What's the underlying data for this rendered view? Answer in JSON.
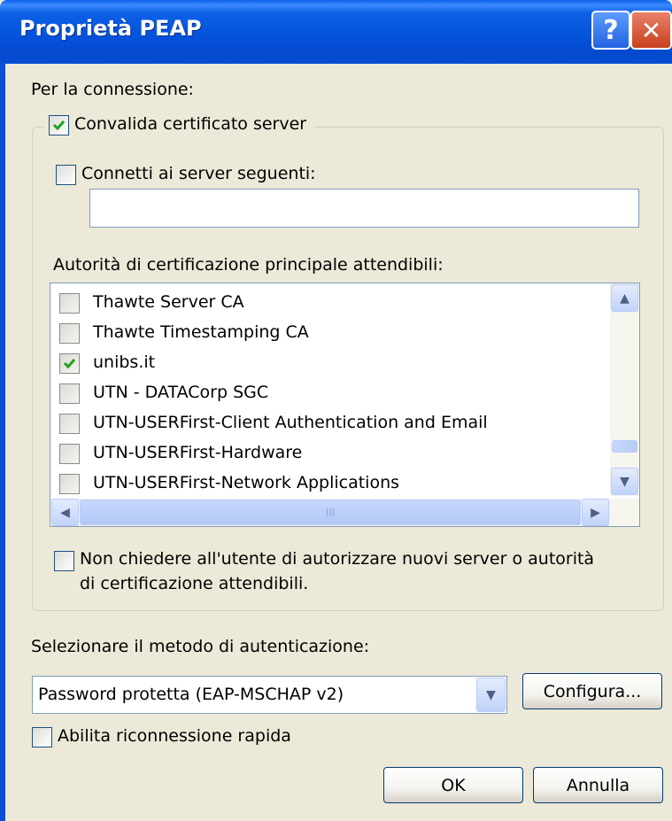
{
  "window": {
    "title": "Proprietà PEAP",
    "help_icon": "?",
    "close_icon": "✕"
  },
  "connection_label": "Per la connessione:",
  "validate_server_cert": {
    "label": "Convalida certificato server",
    "checked": true
  },
  "connect_to_servers": {
    "label": "Connetti ai server seguenti:",
    "checked": false,
    "value": ""
  },
  "trusted_root_ca": {
    "label": "Autorità di certificazione principale attendibili:",
    "items": [
      {
        "label": "Thawte Server CA",
        "checked": false
      },
      {
        "label": "Thawte Timestamping CA",
        "checked": false
      },
      {
        "label": "unibs.it",
        "checked": true
      },
      {
        "label": "UTN - DATACorp SGC",
        "checked": false
      },
      {
        "label": "UTN-USERFirst-Client Authentication and Email",
        "checked": false
      },
      {
        "label": "UTN-USERFirst-Hardware",
        "checked": false
      },
      {
        "label": "UTN-USERFirst-Network Applications",
        "checked": false
      }
    ],
    "hscroll_grip": "III"
  },
  "no_prompt": {
    "line1": "Non chiedere all'utente di autorizzare nuovi server o autorità",
    "line2": "di certificazione attendibili.",
    "checked": false
  },
  "auth_method": {
    "label": "Selezionare il metodo di autenticazione:",
    "selected": "Password protetta (EAP-MSCHAP v2)",
    "configure_label": "Configura..."
  },
  "fast_reconnect": {
    "label": "Abilita riconnessione rapida",
    "checked": false
  },
  "buttons": {
    "ok": "OK",
    "cancel": "Annulla"
  },
  "colors": {
    "titlebar": "#0553DC",
    "dialog_bg": "#ECE9D8",
    "checkmark": "#21A121"
  }
}
